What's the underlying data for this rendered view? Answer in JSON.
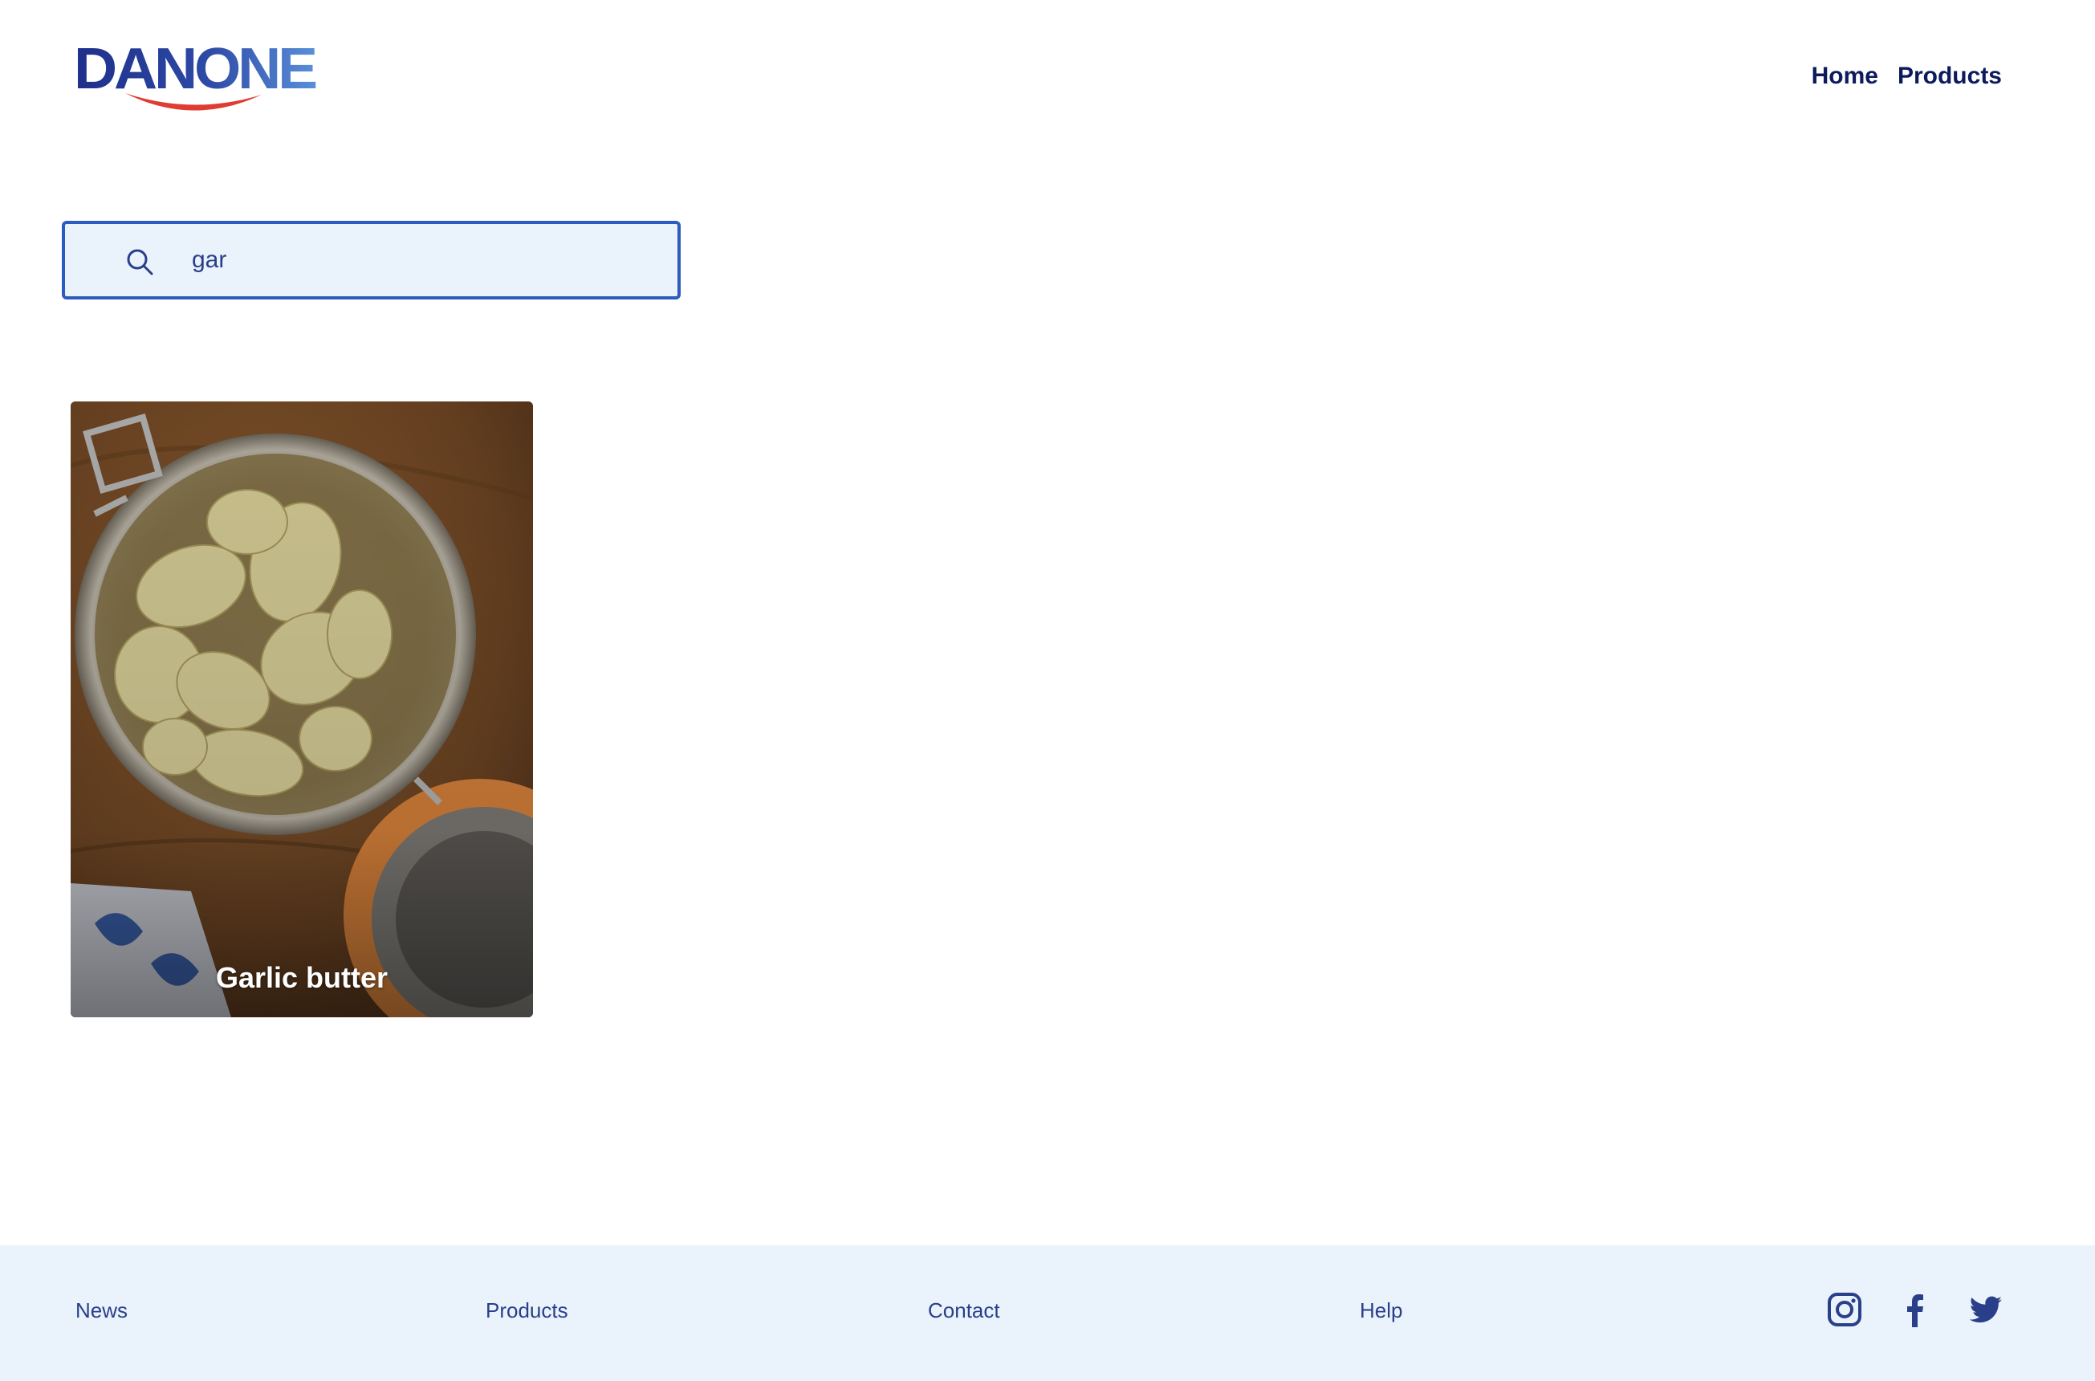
{
  "header": {
    "brand": "DANONE",
    "nav": [
      {
        "label": "Home"
      },
      {
        "label": "Products"
      }
    ]
  },
  "search": {
    "value": "gar",
    "placeholder": ""
  },
  "results": [
    {
      "title": "Garlic butter"
    }
  ],
  "footer": {
    "links": [
      {
        "label": "News"
      },
      {
        "label": "Products"
      },
      {
        "label": "Contact"
      },
      {
        "label": "Help"
      }
    ],
    "social": [
      "instagram-icon",
      "facebook-icon",
      "twitter-icon"
    ]
  },
  "colors": {
    "brand_blue": "#1f3a93",
    "nav_text": "#0d1a5c",
    "search_border": "#2c5bbf",
    "search_bg": "#eaf2fc",
    "footer_bg": "#eaf2fc",
    "smile_red": "#e03c31"
  }
}
